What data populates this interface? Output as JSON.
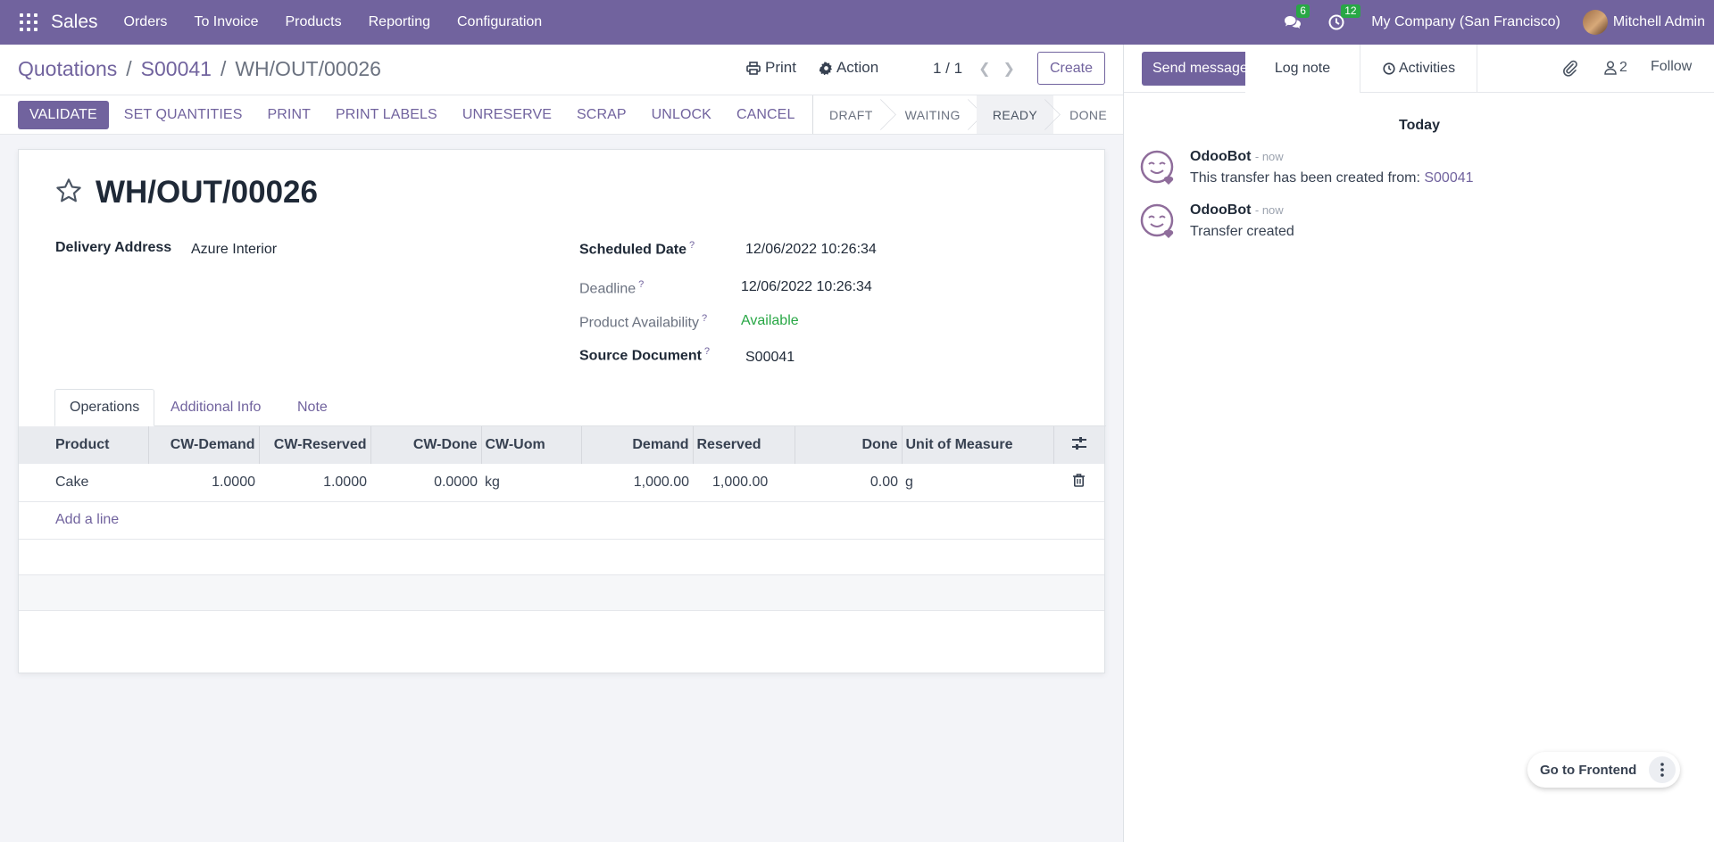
{
  "navbar": {
    "app_name": "Sales",
    "menu": [
      "Orders",
      "To Invoice",
      "Products",
      "Reporting",
      "Configuration"
    ],
    "messages_count": "6",
    "activities_count": "12",
    "company": "My Company (San Francisco)",
    "user": "Mitchell Admin"
  },
  "breadcrumb": {
    "items": [
      "Quotations",
      "S00041"
    ],
    "current": "WH/OUT/00026"
  },
  "control_panel": {
    "print_label": "Print",
    "action_label": "Action",
    "pager": "1 / 1",
    "create_label": "Create"
  },
  "status_buttons": [
    "VALIDATE",
    "SET QUANTITIES",
    "PRINT",
    "PRINT LABELS",
    "UNRESERVE",
    "SCRAP",
    "UNLOCK",
    "CANCEL"
  ],
  "stages": [
    "DRAFT",
    "WAITING",
    "READY",
    "DONE"
  ],
  "active_stage": "READY",
  "form": {
    "title": "WH/OUT/00026",
    "delivery_address_label": "Delivery Address",
    "delivery_address": "Azure Interior",
    "scheduled_date_label": "Scheduled Date",
    "scheduled_date": "12/06/2022 10:26:34",
    "deadline_label": "Deadline",
    "deadline": "12/06/2022 10:26:34",
    "availability_label": "Product Availability",
    "availability": "Available",
    "source_document_label": "Source Document",
    "source_document": "S00041",
    "help_mark": "?"
  },
  "tabs": [
    "Operations",
    "Additional Info",
    "Note"
  ],
  "operations": {
    "columns": [
      "Product",
      "CW-Demand",
      "CW-Reserved",
      "CW-Done",
      "CW-Uom",
      "Demand",
      "Reserved",
      "Done",
      "Unit of Measure"
    ],
    "rows": [
      [
        "Cake",
        "1.0000",
        "1.0000",
        "0.0000",
        "kg",
        "1,000.00",
        "1,000.00",
        "0.00",
        "g"
      ]
    ],
    "add_line": "Add a line"
  },
  "chatter": {
    "send_message": "Send message",
    "log_note": "Log note",
    "activities": "Activities",
    "followers_count": "2",
    "follow": "Follow",
    "date_separator": "Today",
    "messages": [
      {
        "author": "OdooBot",
        "time": "- now",
        "text": "This transfer has been created from: ",
        "link": "S00041"
      },
      {
        "author": "OdooBot",
        "time": "- now",
        "text": "Transfer created",
        "link": ""
      }
    ]
  },
  "frontend_button": "Go to Frontend",
  "colors": {
    "brand": "#71639e",
    "success": "#28a745"
  }
}
